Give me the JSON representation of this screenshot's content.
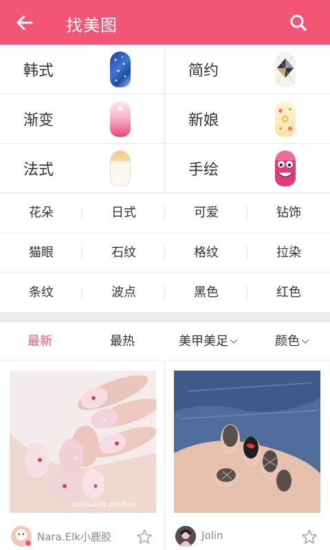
{
  "header": {
    "title": "找美图",
    "background_color": "#f55574",
    "back_icon": "arrow-left-icon",
    "search_icon": "search-icon"
  },
  "big_categories": [
    {
      "label": "韩式",
      "icon": "blue-glitter-nail"
    },
    {
      "label": "简约",
      "icon": "argyle-nail"
    },
    {
      "label": "渐变",
      "icon": "pink-gradient-nail"
    },
    {
      "label": "新娘",
      "icon": "bridal-floral-nail"
    },
    {
      "label": "法式",
      "icon": "french-tip-nail"
    },
    {
      "label": "手绘",
      "icon": "hand-painted-cat-nail"
    }
  ],
  "small_categories": [
    [
      "花朵",
      "日式",
      "可爱",
      "钻饰"
    ],
    [
      "猫眼",
      "石纹",
      "格纹",
      "拉染"
    ],
    [
      "条纹",
      "波点",
      "黑色",
      "红色"
    ]
  ],
  "tabs": [
    {
      "label": "最新",
      "active": true
    },
    {
      "label": "最热",
      "active": false
    },
    {
      "label": "美甲美足",
      "active": false,
      "dropdown": true
    },
    {
      "label": "颜色",
      "active": false,
      "dropdown": true
    }
  ],
  "accent_color": "#f55574",
  "feed": [
    {
      "author": "Nara.Elk小鹿胶",
      "watermark": "nailsalon anchoo",
      "image": "pink-floral-manicure-photo",
      "favorite_icon": "star-outline-icon"
    },
    {
      "author": "Jolin",
      "image": "black-lace-manicure-photo",
      "favorite_icon": "star-outline-icon"
    }
  ]
}
